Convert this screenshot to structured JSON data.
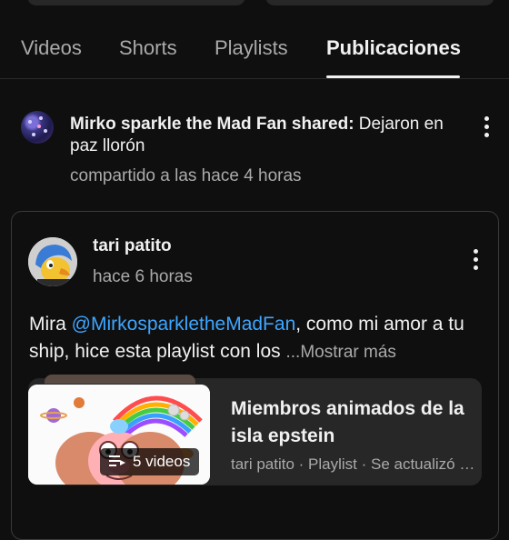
{
  "tabs": [
    {
      "label": "Videos"
    },
    {
      "label": "Shorts"
    },
    {
      "label": "Playlists"
    },
    {
      "label": "Publicaciones"
    }
  ],
  "share_post": {
    "author_prefix": "Mirko sparkle the Mad Fan shared:",
    "message": " Dejaron en paz llorón",
    "time": "compartido a las hace 4 horas"
  },
  "post": {
    "author": "tari patito",
    "time": "hace 6 horas",
    "text_before": "Mira ",
    "mention": "@MirkosparkletheMadFan",
    "text_after": ", como mi amor a tu ship, hice esta playlist con los ",
    "more": "...Mostrar más"
  },
  "playlist": {
    "video_count": "5 videos",
    "title": "Miembros animados de la isla epstein",
    "meta": "tari patito · Playlist · Se actualizó hace poco"
  }
}
